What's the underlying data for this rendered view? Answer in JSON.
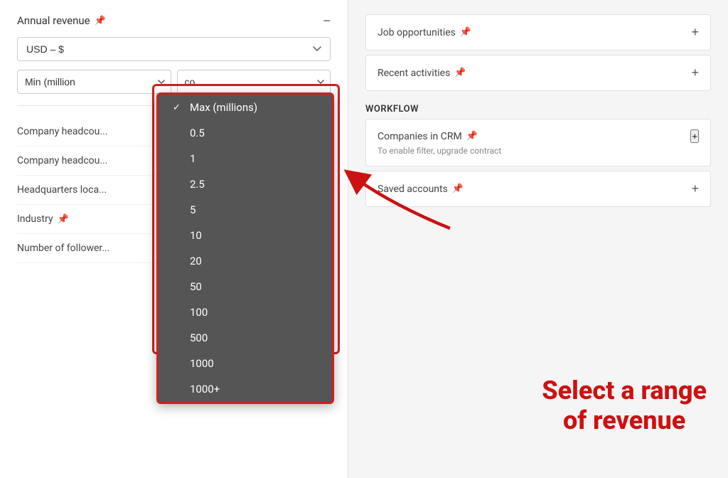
{
  "left": {
    "annual_revenue": {
      "title": "Annual revenue",
      "currency_label": "USD – $",
      "min_label": "Min (million",
      "min_placeholder": "Min (million",
      "max_placeholder": "Max (millions)",
      "collapse_icon": "−"
    },
    "filters": [
      {
        "id": "company-headcount-1",
        "label": "Company headcou..."
      },
      {
        "id": "company-headcount-2",
        "label": "Company headcou..."
      },
      {
        "id": "headquarters-location",
        "label": "Headquarters loca..."
      },
      {
        "id": "industry",
        "label": "Industry"
      },
      {
        "id": "number-of-followers",
        "label": "Number of follower..."
      }
    ],
    "dropdown": {
      "selected": "Max (millions)",
      "options": [
        {
          "value": "max-millions",
          "label": "Max (millions)",
          "selected": true
        },
        {
          "value": "0.5",
          "label": "0.5"
        },
        {
          "value": "1",
          "label": "1"
        },
        {
          "value": "2.5",
          "label": "2.5"
        },
        {
          "value": "5",
          "label": "5"
        },
        {
          "value": "10",
          "label": "10"
        },
        {
          "value": "20",
          "label": "20"
        },
        {
          "value": "50",
          "label": "50"
        },
        {
          "value": "100",
          "label": "100"
        },
        {
          "value": "500",
          "label": "500"
        },
        {
          "value": "1000",
          "label": "1000"
        },
        {
          "value": "1000+",
          "label": "1000+"
        }
      ]
    }
  },
  "right": {
    "items": [
      {
        "id": "job-opportunities",
        "label": "Job opportunities"
      },
      {
        "id": "recent-activities",
        "label": "Recent activities"
      }
    ],
    "workflow": {
      "label": "Workflow",
      "items": [
        {
          "id": "companies-in-crm",
          "label": "Companies in CRM",
          "subtitle": "To enable filter, upgrade contract"
        },
        {
          "id": "saved-accounts",
          "label": "Saved accounts"
        }
      ]
    }
  },
  "annotation": {
    "select_range_text": "Select a range\nof revenue"
  },
  "icons": {
    "pin": "📌",
    "plus": "+",
    "minus": "−",
    "check": "✓"
  }
}
